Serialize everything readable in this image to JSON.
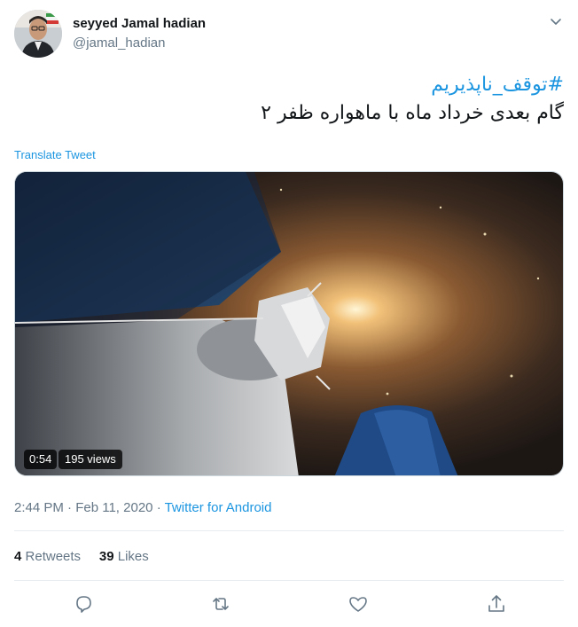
{
  "user": {
    "name": "seyyed Jamal hadian",
    "handle": "@jamal_hadian",
    "avatar_icon": "user-avatar"
  },
  "tweet": {
    "hashtag": "#توقف_ناپذیریم",
    "text": "گام بعدی خرداد ماه با ماهواره ظفر ۲",
    "translate_label": "Translate Tweet"
  },
  "media": {
    "duration": "0:54",
    "views": "195 views"
  },
  "meta": {
    "time": "2:44 PM",
    "separator": "·",
    "date": "Feb 11, 2020",
    "source": "Twitter for Android"
  },
  "stats": {
    "retweets_count": "4",
    "retweets_label": "Retweets",
    "likes_count": "39",
    "likes_label": "Likes"
  },
  "actions": [
    "reply-icon",
    "retweet-icon",
    "like-icon",
    "share-icon"
  ],
  "colors": {
    "link": "#1b95e0",
    "secondary_text": "#657786",
    "primary_text": "#14171a",
    "divider": "#e6ecf0"
  }
}
